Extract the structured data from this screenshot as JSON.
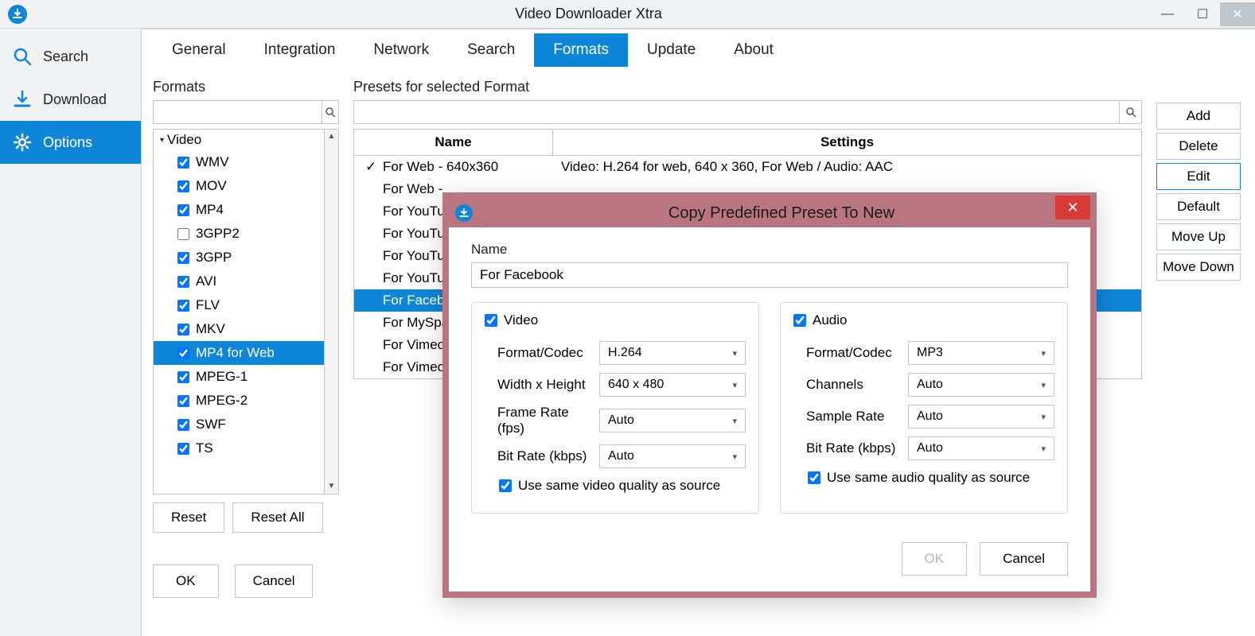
{
  "app": {
    "title": "Video Downloader Xtra"
  },
  "sidebar": {
    "items": [
      {
        "label": "Search"
      },
      {
        "label": "Download"
      },
      {
        "label": "Options"
      }
    ]
  },
  "tabs": {
    "items": [
      "General",
      "Integration",
      "Network",
      "Search",
      "Formats",
      "Update",
      "About"
    ],
    "active": "Formats"
  },
  "formats": {
    "section_label": "Formats",
    "group_label": "Video",
    "items": [
      {
        "label": "WMV",
        "checked": true
      },
      {
        "label": "MOV",
        "checked": true
      },
      {
        "label": "MP4",
        "checked": true
      },
      {
        "label": "3GPP2",
        "checked": false
      },
      {
        "label": "3GPP",
        "checked": true
      },
      {
        "label": "AVI",
        "checked": true
      },
      {
        "label": "FLV",
        "checked": true
      },
      {
        "label": "MKV",
        "checked": true
      },
      {
        "label": "MP4 for Web",
        "checked": true,
        "selected": true
      },
      {
        "label": "MPEG-1",
        "checked": true
      },
      {
        "label": "MPEG-2",
        "checked": true
      },
      {
        "label": "SWF",
        "checked": true
      },
      {
        "label": "TS",
        "checked": true
      }
    ],
    "reset_label": "Reset",
    "reset_all_label": "Reset All",
    "ok_label": "OK",
    "cancel_label": "Cancel"
  },
  "presets": {
    "section_label": "Presets for selected Format",
    "columns": {
      "name": "Name",
      "settings": "Settings"
    },
    "rows": [
      {
        "name": "For Web - 640x360",
        "settings": "Video: H.264 for web, 640 x 360, For Web / Audio: AAC",
        "checked": true
      },
      {
        "name": "For Web - ",
        "settings": ""
      },
      {
        "name": "For YouTu",
        "settings": ""
      },
      {
        "name": "For YouTu",
        "settings": ""
      },
      {
        "name": "For YouTu",
        "settings": ""
      },
      {
        "name": "For YouTu",
        "settings": ""
      },
      {
        "name": "For Facebo",
        "settings": "",
        "selected": true
      },
      {
        "name": "For MySpa",
        "settings": ""
      },
      {
        "name": "For Vimeo",
        "settings": ""
      },
      {
        "name": "For Vimeo",
        "settings": ""
      }
    ]
  },
  "actions": {
    "add": "Add",
    "delete": "Delete",
    "edit": "Edit",
    "default": "Default",
    "moveup": "Move Up",
    "movedown": "Move Down"
  },
  "dialog": {
    "title": "Copy Predefined Preset To New",
    "name_label": "Name",
    "name_value": "For Facebook",
    "video": {
      "header": "Video",
      "format_label": "Format/Codec",
      "format_value": "H.264",
      "dim_label": "Width x Height",
      "dim_value": "640 x 480",
      "fps_label": "Frame Rate (fps)",
      "fps_value": "Auto",
      "br_label": "Bit Rate (kbps)",
      "br_value": "Auto",
      "same_label": "Use same video quality as source"
    },
    "audio": {
      "header": "Audio",
      "format_label": "Format/Codec",
      "format_value": "MP3",
      "ch_label": "Channels",
      "ch_value": "Auto",
      "sr_label": "Sample Rate",
      "sr_value": "Auto",
      "br_label": "Bit Rate (kbps)",
      "br_value": "Auto",
      "same_label": "Use same audio quality as source"
    },
    "ok_label": "OK",
    "cancel_label": "Cancel"
  }
}
